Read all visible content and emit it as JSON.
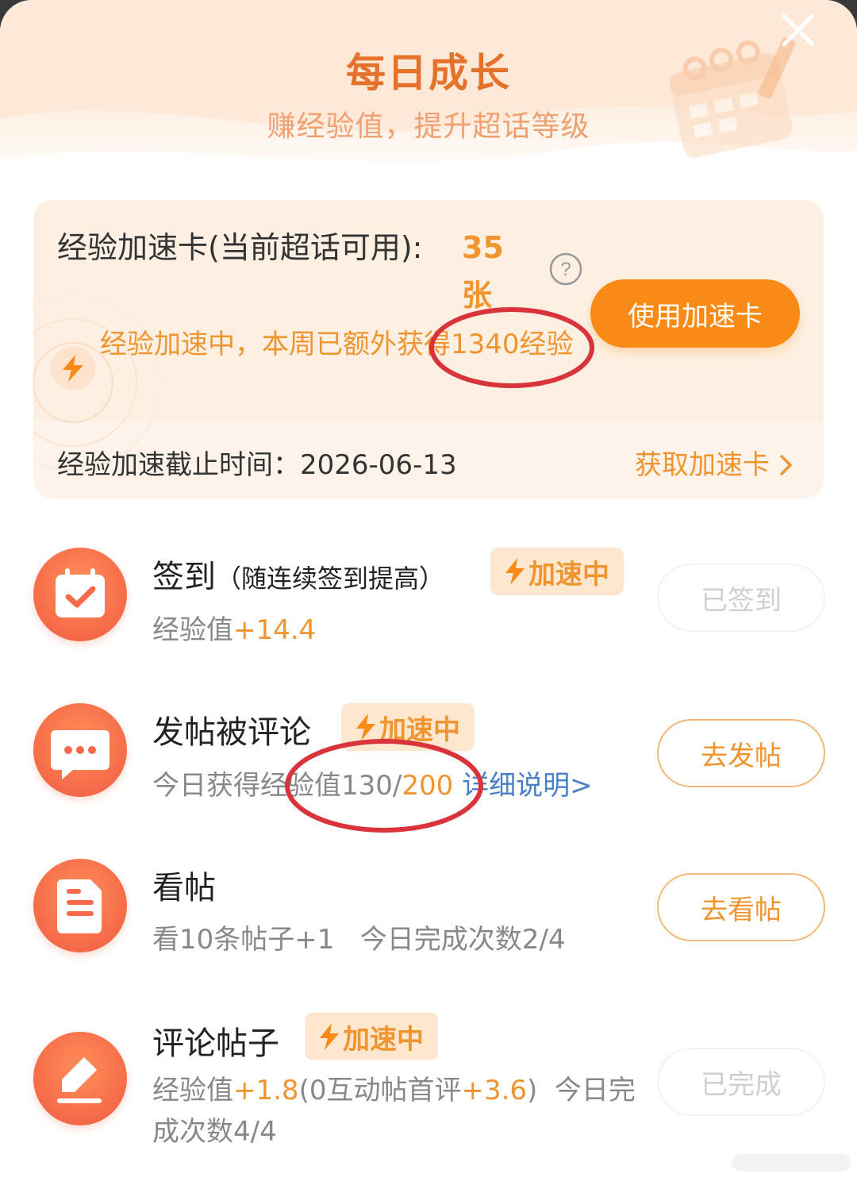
{
  "header": {
    "title": "每日成长",
    "subtitle": "赚经验值，提升超话等级"
  },
  "boost_card": {
    "label": "经验加速卡(当前超话可用):",
    "count": "35张",
    "use_button": "使用加速卡",
    "status_text": "经验加速中，本周已额外获得1340经验",
    "deadline_label": "经验加速截止时间：",
    "deadline_date": "2026-06-13",
    "get_card_link": "获取加速卡"
  },
  "badge_label": "加速中",
  "tasks": [
    {
      "title": "签到",
      "note": "（随连续签到提高）",
      "sub_prefix": "经验值",
      "sub_value": "+14.4",
      "button": "已签到",
      "button_state": "done"
    },
    {
      "title": "发帖被评论",
      "sub_prefix": "今日获得经验值130/",
      "sub_value": "200",
      "sub_link": "详细说明>",
      "button": "去发帖",
      "button_state": "active"
    },
    {
      "title": "看帖",
      "sub": "看10条帖子+1   今日完成次数2/4",
      "button": "去看帖",
      "button_state": "active"
    },
    {
      "title": "评论帖子",
      "sub_a": "经验值",
      "sub_b": "+1.8",
      "sub_c": "(0互动帖首评",
      "sub_d": "+3.6",
      "sub_e": ")  今日完",
      "sub_line2": "成次数4/4",
      "button": "已完成",
      "button_state": "done"
    }
  ],
  "colors": {
    "accent": "#f0942e",
    "button": "#f88a15",
    "title": "#e5722b",
    "icon_bg": "#f56a48",
    "link": "#4a7fc9",
    "annotation": "#d9333b"
  }
}
